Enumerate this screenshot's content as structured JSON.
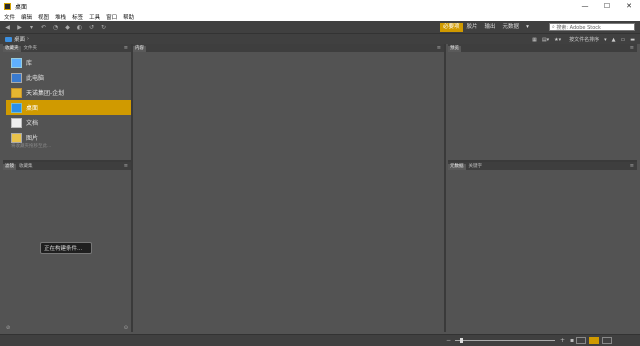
{
  "window": {
    "title": "桌面",
    "controls": [
      "—",
      "☐",
      "✕"
    ]
  },
  "menu": {
    "items": [
      "文件",
      "编辑",
      "视图",
      "堆栈",
      "标签",
      "工具",
      "窗口",
      "帮助"
    ]
  },
  "toolbar": {
    "workspaces": [
      "必要项",
      "胶片",
      "输出",
      "元数据"
    ],
    "active_workspace": "必要项",
    "search_placeholder": "搜索: Adobe Stock"
  },
  "pathbar": {
    "current": "桌面"
  },
  "sort": {
    "label": "按文件名排序"
  },
  "panels": {
    "favorites_tabs": [
      "收藏夹",
      "文件夹"
    ],
    "filter_tabs": [
      "滤镜",
      "收藏集"
    ],
    "content_tab": "内容",
    "preview_tab": "预览",
    "metadata_tabs": [
      "元数据",
      "关键字"
    ]
  },
  "favorites": {
    "items": [
      {
        "label": "库",
        "icon": "library-icon"
      },
      {
        "label": "此电脑",
        "icon": "computer-icon"
      },
      {
        "label": "天诺集团-企划",
        "icon": "folder-icon"
      },
      {
        "label": "桌面",
        "icon": "desktop-icon",
        "selected": true
      },
      {
        "label": "文档",
        "icon": "document-icon"
      },
      {
        "label": "图片",
        "icon": "pictures-icon"
      }
    ],
    "hint": "将收藏夹拖移至此..."
  },
  "filter": {
    "status": "正在构建条件..."
  },
  "status": {
    "thumbnail_size": 0.05
  },
  "colors": {
    "accent": "#d09a00",
    "panel_bg": "#535353"
  }
}
